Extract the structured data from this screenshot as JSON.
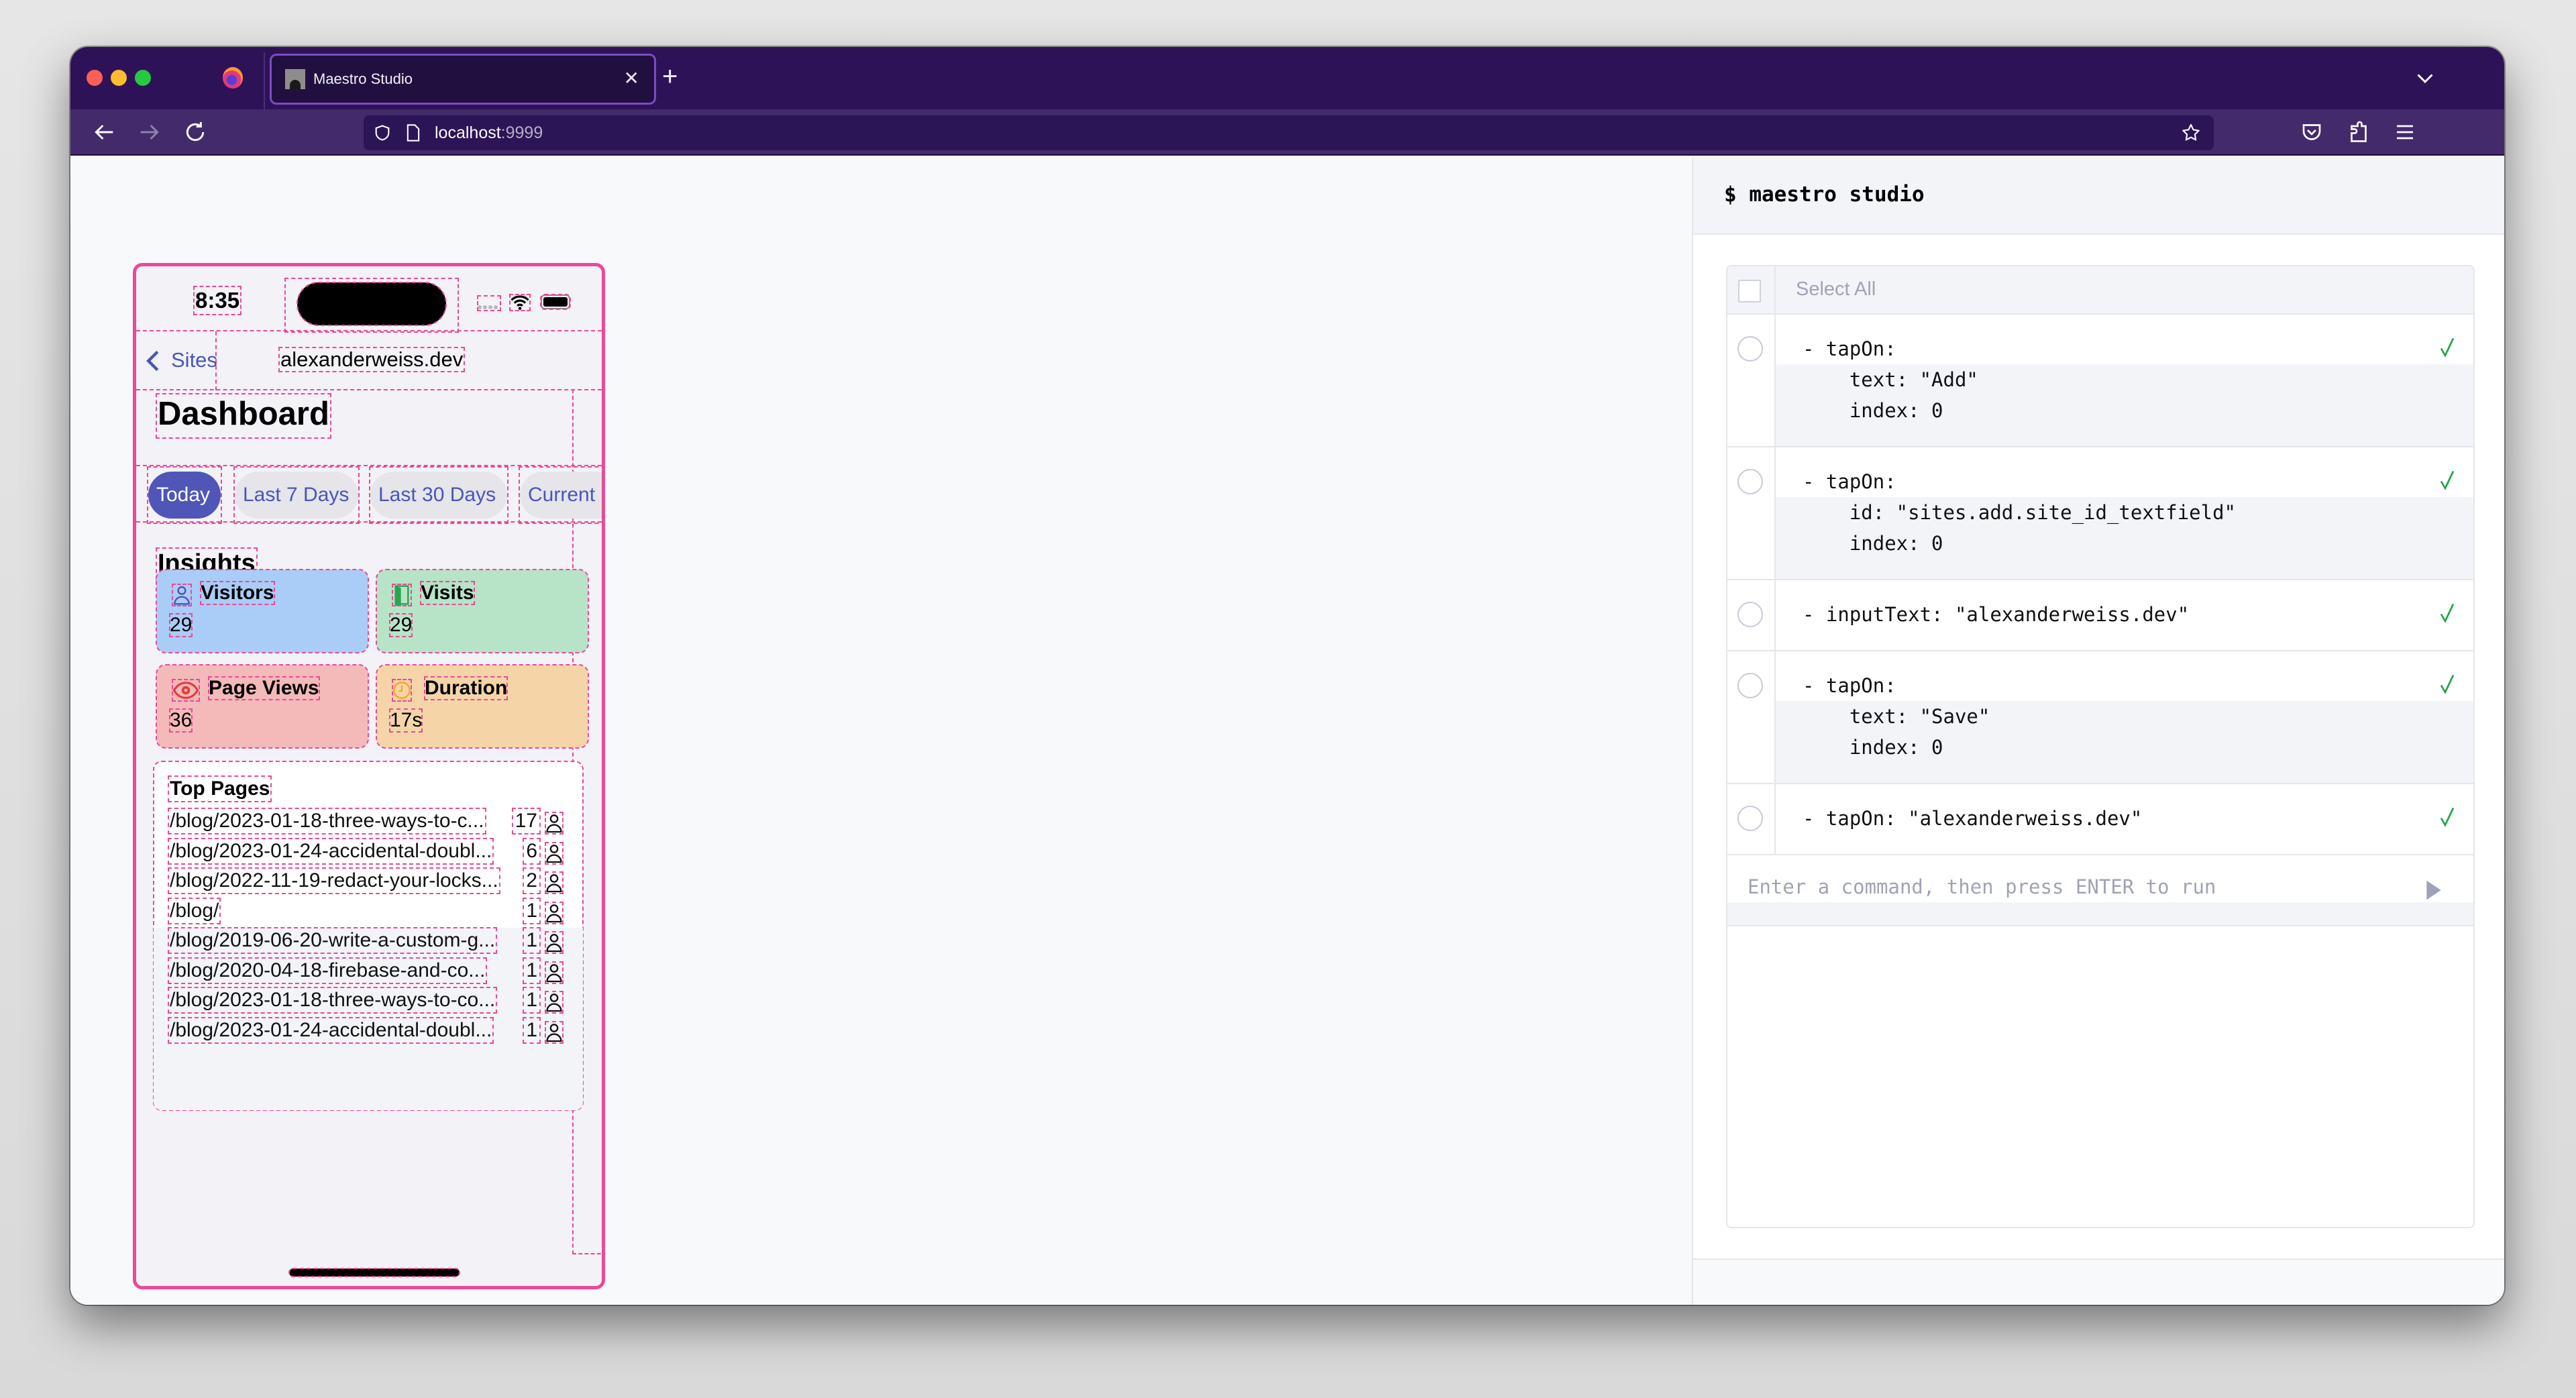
{
  "browser": {
    "tab": {
      "title": "Maestro Studio",
      "close_icon": "close-icon"
    },
    "new_tab_label": "+",
    "url": {
      "host": "localhost",
      "port": ":9999"
    },
    "icons": [
      "back-arrow-icon",
      "forward-arrow-icon",
      "reload-icon",
      "shield-icon",
      "page-icon",
      "star-icon",
      "pocket-icon",
      "extensions-icon",
      "menu-icon",
      "tab-list-chevron-icon"
    ]
  },
  "phone": {
    "status": {
      "time": "8:35"
    },
    "nav": {
      "back_label": "Sites",
      "title": "alexanderweiss.dev"
    },
    "page_title": "Dashboard",
    "ranges": [
      {
        "label": "Today",
        "active": true
      },
      {
        "label": "Last 7 Days",
        "active": false
      },
      {
        "label": "Last 30 Days",
        "active": false
      },
      {
        "label": "Current",
        "active": false
      }
    ],
    "insights_title": "Insights",
    "cards": [
      {
        "label": "Visitors",
        "value": "29",
        "icon": "person-icon",
        "color": "#a9cdf7"
      },
      {
        "label": "Visits",
        "value": "29",
        "icon": "door-icon",
        "color": "#b7e4c7"
      },
      {
        "label": "Page Views",
        "value": "36",
        "icon": "eye-icon",
        "color": "#f4b9b9"
      },
      {
        "label": "Duration",
        "value": "17s",
        "icon": "clock-icon",
        "color": "#f5d5a8"
      }
    ],
    "top_pages": {
      "title": "Top Pages",
      "rows": [
        {
          "path": "/blog/2023-01-18-three-ways-to-c...",
          "count": "17"
        },
        {
          "path": "/blog/2023-01-24-accidental-doubl...",
          "count": "6"
        },
        {
          "path": "/blog/2022-11-19-redact-your-locks...",
          "count": "2"
        },
        {
          "path": "/blog/",
          "count": "1"
        },
        {
          "path": "/blog/2019-06-20-write-a-custom-g...",
          "count": "1"
        },
        {
          "path": "/blog/2020-04-18-firebase-and-co...",
          "count": "1"
        },
        {
          "path": "/blog/2023-01-18-three-ways-to-co...",
          "count": "1"
        },
        {
          "path": "/blog/2023-01-24-accidental-doubl...",
          "count": "1"
        }
      ]
    }
  },
  "studio": {
    "title": "$ maestro studio",
    "select_all_label": "Select All",
    "commands": [
      {
        "lines": [
          "- tapOn:",
          "    text: \"Add\"",
          "    index: 0"
        ],
        "status": "success"
      },
      {
        "lines": [
          "- tapOn:",
          "    id: \"sites.add.site_id_textfield\"",
          "    index: 0"
        ],
        "status": "success"
      },
      {
        "lines": [
          "- inputText: \"alexanderweiss.dev\""
        ],
        "status": "success"
      },
      {
        "lines": [
          "- tapOn:",
          "    text: \"Save\"",
          "    index: 0"
        ],
        "status": "success"
      },
      {
        "lines": [
          "- tapOn: \"alexanderweiss.dev\""
        ],
        "status": "success"
      }
    ],
    "input": {
      "value": "",
      "placeholder": "Enter a command, then press ENTER to run"
    },
    "colors": {
      "success": "#22a447",
      "accent": "#4f56b8",
      "highlight": "#ec4899"
    }
  }
}
